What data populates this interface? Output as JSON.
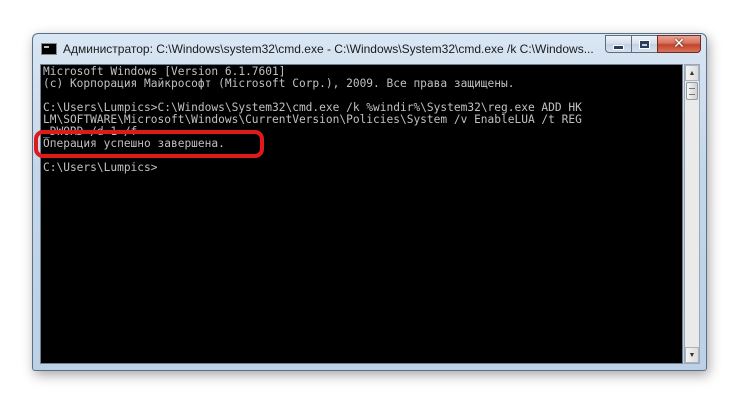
{
  "window": {
    "title": "Администратор: C:\\Windows\\system32\\cmd.exe - C:\\Windows\\System32\\cmd.exe  /k C:\\Windows..."
  },
  "controls": {
    "close_label": "✕"
  },
  "console": {
    "lines": [
      "Microsoft Windows [Version 6.1.7601]",
      "(c) Корпорация Майкрософт (Microsoft Corp.), 2009. Все права защищены.",
      "",
      "C:\\Users\\Lumpics>C:\\Windows\\System32\\cmd.exe /k %windir%\\System32\\reg.exe ADD HK",
      "LM\\SOFTWARE\\Microsoft\\Windows\\CurrentVersion\\Policies\\System /v EnableLUA /t REG",
      "_DWORD /d 1 /f",
      "Операция успешно завершена.",
      "",
      "C:\\Users\\Lumpics>"
    ]
  },
  "colors": {
    "console_bg": "#000000",
    "console_fg": "#c0c0c0",
    "highlight": "#e0191b"
  }
}
